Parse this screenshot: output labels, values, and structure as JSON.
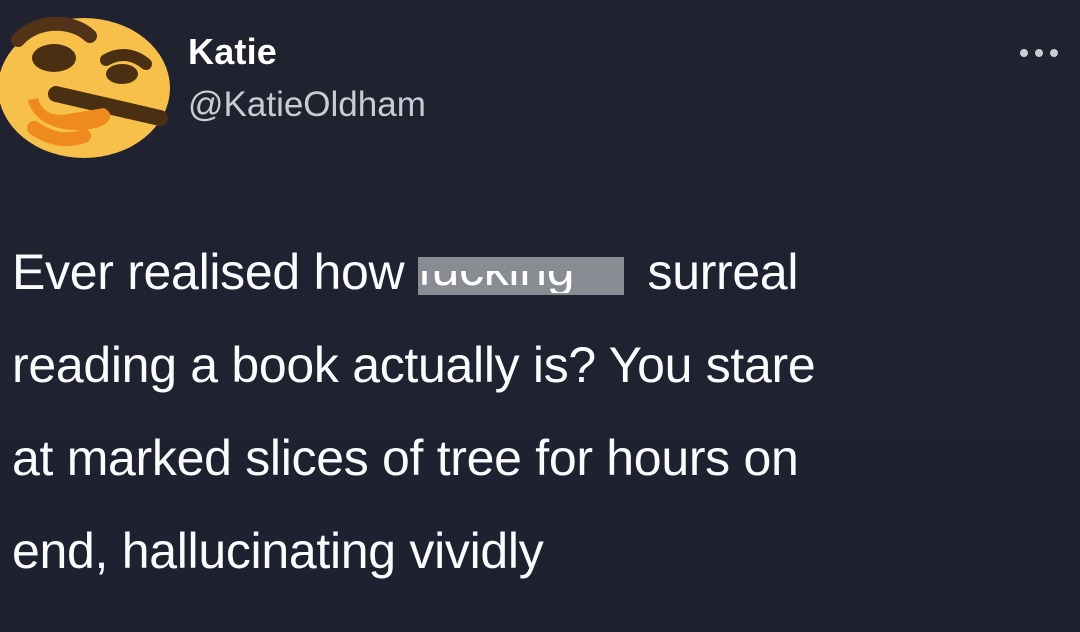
{
  "author": {
    "name": "Katie",
    "handle": "@KatieOldham",
    "avatar_icon": "thinking-face-icon"
  },
  "more_icon": "ellipsis-icon",
  "tweet": {
    "line1_before": "Ever realised how ",
    "censored_word": "fucking",
    "line1_after": " surreal",
    "line2": "reading a book actually is? You stare",
    "line3": "at marked slices of tree for hours on",
    "line4": "end, hallucinating vividly"
  },
  "colors": {
    "background": "#1f2230",
    "text": "#ffffff",
    "handle": "#c8ccd4",
    "censor_bar": "#8a8c94",
    "avatar_yellow": "#f7c04a"
  }
}
